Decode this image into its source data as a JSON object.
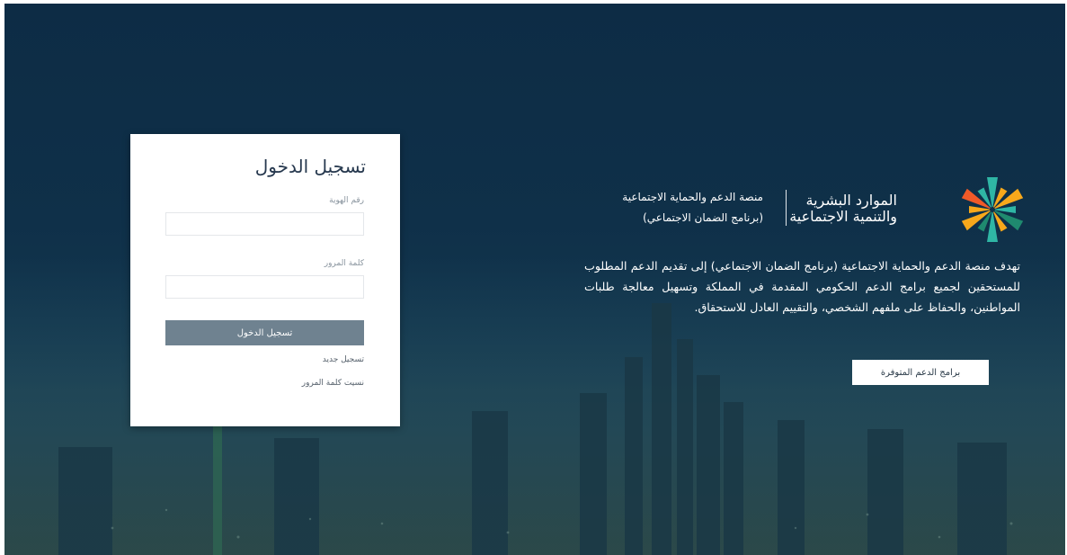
{
  "login": {
    "title": "تسجيل الدخول",
    "id_label": "رقم الهوية",
    "id_value": "",
    "password_label": "كلمة المرور",
    "password_value": "",
    "submit_label": "تسجيل الدخول",
    "register_link": "تسجيل جديد",
    "forgot_link": "نسيت كلمة المرور"
  },
  "brand": {
    "line1": "الموارد البشرية",
    "line2": "والتنمية الاجتماعية",
    "logo_icon": "ministry-logo-icon",
    "logo_colors": [
      "#f7a81b",
      "#2fb6a5",
      "#1f8a6f",
      "#f05a28"
    ]
  },
  "platform": {
    "line1": "منصة الدعم والحماية الاجتماعية",
    "line2": "(برنامج الضمان الاجتماعي)"
  },
  "description": "تهدف منصة الدعم والحماية الاجتماعية (برنامج الضمان الاجتماعي) إلى تقديم الدعم المطلوب للمستحقين لجميع برامج الدعم الحكومي المقدمة في المملكة وتسهيل معالجة طلبات المواطنين، والحفاظ على ملفهم الشخصي، والتقييم العادل للاستحقاق.",
  "cta": {
    "programs_label": "برامج الدعم المتوفرة"
  },
  "colors": {
    "background": "#0f3049",
    "button": "#6f8290",
    "title": "#26384e"
  }
}
